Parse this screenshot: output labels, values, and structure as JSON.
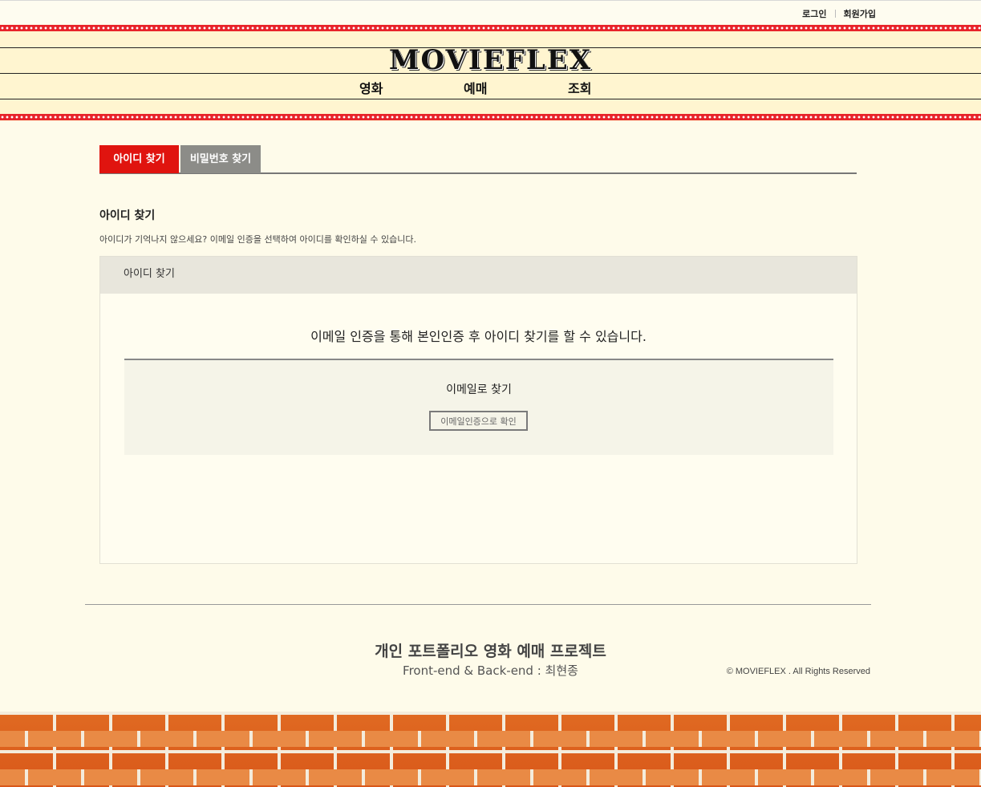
{
  "header": {
    "util_links": {
      "login": "로그인",
      "signup": "회원가입"
    },
    "logo": "MOVIEFLEX",
    "nav": [
      {
        "label": "영화"
      },
      {
        "label": "예매"
      },
      {
        "label": "조회"
      }
    ]
  },
  "tabs": [
    {
      "label": "아이디 찾기",
      "active": true
    },
    {
      "label": "비밀번호 찾기",
      "active": false
    }
  ],
  "section": {
    "title": "아이디 찾기",
    "description": "아이디가 기억나지 않으세요? 이메일 인증을 선택하여 아이디를 확인하실 수 있습니다."
  },
  "panel": {
    "header": "아이디 찾기",
    "message": "이메일 인증을 통해 본인인증 후 아이디 찾기를 할 수 있습니다.",
    "find_title": "이메일로 찾기",
    "find_button": "이메일인증으로 확인"
  },
  "footer": {
    "title": "개인 포트폴리오 영화 예매 프로젝트",
    "subtitle": "Front-end & Back-end : 최현종",
    "copyright": "© MOVIEFLEX . All Rights Reserved"
  },
  "colors": {
    "accent_red": "#e0140f",
    "tab_inactive": "#8c8c88",
    "page_bg": "#fefbea",
    "brick": "#e06a22"
  }
}
